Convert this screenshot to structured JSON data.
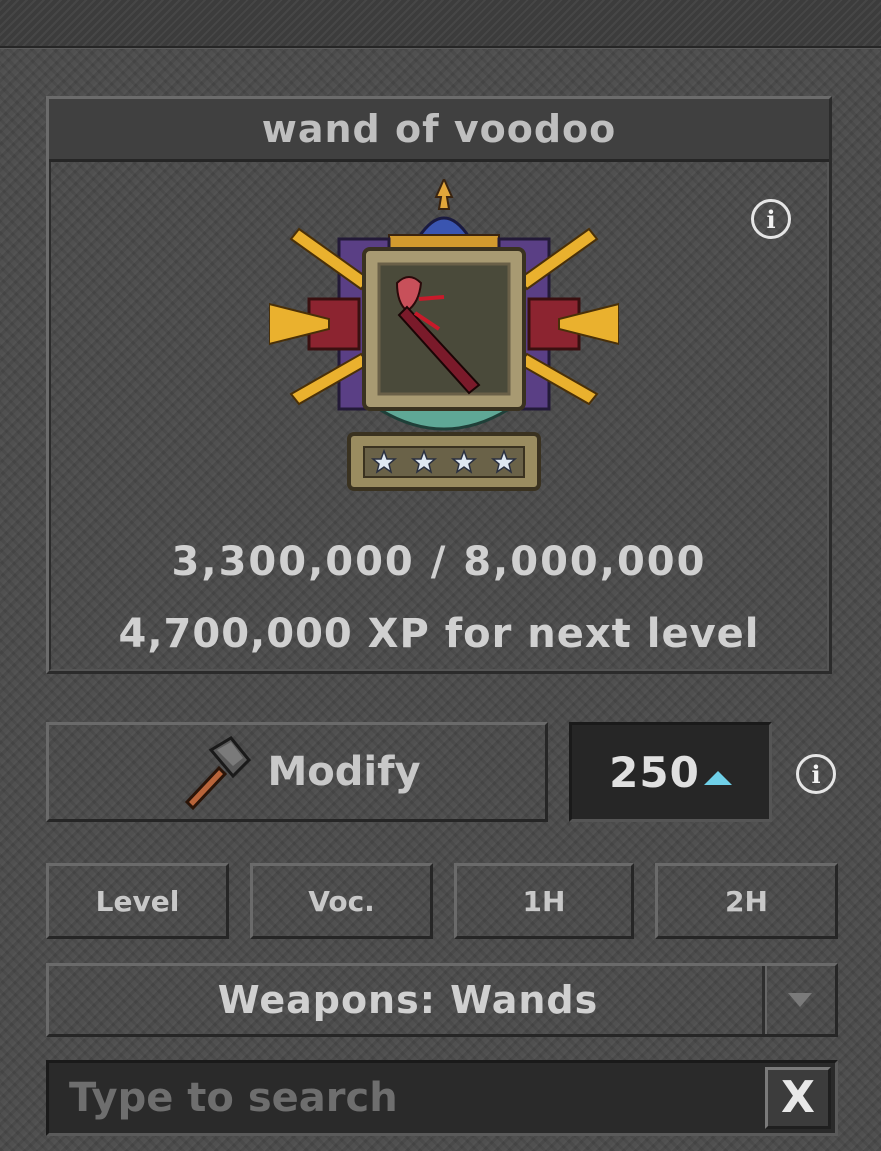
{
  "item": {
    "name": "wand of voodoo",
    "stars": 4,
    "xp_progress": "3,300,000 / 8,000,000",
    "xp_next": "4,700,000 XP for next level"
  },
  "actions": {
    "modify_label": "Modify",
    "cost": "250"
  },
  "filters": [
    {
      "label": "Level"
    },
    {
      "label": "Voc."
    },
    {
      "label": "1H"
    },
    {
      "label": "2H"
    }
  ],
  "category_select": {
    "selected": "Weapons: Wands"
  },
  "search": {
    "placeholder": "Type to search",
    "value": "",
    "clear_label": "X"
  },
  "icons": {
    "info": "info-circle-icon",
    "hammer": "hammer-icon",
    "currency": "crystal-triangle-icon",
    "dropdown": "chevron-down-icon"
  },
  "colors": {
    "background": "#4a4a4a",
    "text": "#c8c8c8",
    "currency_accent": "#6fd0e8"
  }
}
